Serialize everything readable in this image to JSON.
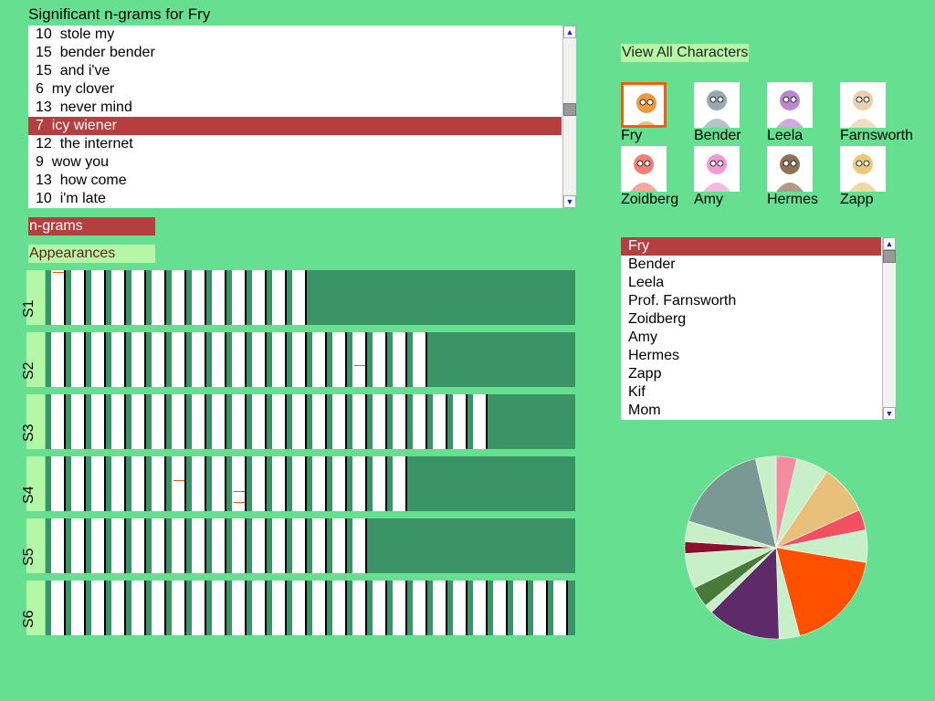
{
  "ngram_panel": {
    "title": "Significant n-grams for Fry",
    "items": [
      {
        "count": "10",
        "text": "stole my"
      },
      {
        "count": "15",
        "text": "bender bender"
      },
      {
        "count": "15",
        "text": "and i've"
      },
      {
        "count": "6",
        "text": "my clover"
      },
      {
        "count": "13",
        "text": "never mind"
      },
      {
        "count": "7",
        "text": "icy wiener",
        "selected": true
      },
      {
        "count": "12",
        "text": "the internet"
      },
      {
        "count": "9",
        "text": "wow you"
      },
      {
        "count": "13",
        "text": "how come"
      },
      {
        "count": "10",
        "text": "i'm late"
      }
    ],
    "scroll_position": 0.45
  },
  "view_toggle": {
    "ngrams_label": "n-grams",
    "appearances_label": "Appearances",
    "active": "n-grams"
  },
  "seasons": [
    {
      "label": "S1",
      "episodes": 13,
      "ticks": [
        {
          "episode": 1,
          "pos": 0.03
        }
      ]
    },
    {
      "label": "S2",
      "episodes": 19,
      "ticks": [
        {
          "episode": 16,
          "pos": 0.6
        }
      ]
    },
    {
      "label": "S3",
      "episodes": 22,
      "ticks": []
    },
    {
      "label": "S4",
      "episodes": 18,
      "ticks": [
        {
          "episode": 7,
          "pos": 0.43
        },
        {
          "episode": 10,
          "pos": 0.63
        },
        {
          "episode": 10,
          "pos": 0.83
        }
      ]
    },
    {
      "label": "S5",
      "episodes": 16,
      "ticks": []
    },
    {
      "label": "S6",
      "episodes": 26,
      "ticks": []
    }
  ],
  "characters_panel": {
    "view_all_label": "View All Characters",
    "cards": [
      {
        "name": "Fry",
        "selected": true,
        "color": "#e8891c"
      },
      {
        "name": "Bender",
        "selected": false,
        "color": "#8a9aa6"
      },
      {
        "name": "Leela",
        "selected": false,
        "color": "#b070c8"
      },
      {
        "name": "Farnsworth",
        "selected": false,
        "color": "#e8c79a"
      },
      {
        "name": "Zoidberg",
        "selected": false,
        "color": "#f06a5a"
      },
      {
        "name": "Amy",
        "selected": false,
        "color": "#ee88cc"
      },
      {
        "name": "Hermes",
        "selected": false,
        "color": "#7a5a3a"
      },
      {
        "name": "Zapp",
        "selected": false,
        "color": "#e8c060"
      }
    ],
    "list": [
      "Fry",
      "Bender",
      "Leela",
      "Prof. Farnsworth",
      "Zoidberg",
      "Amy",
      "Hermes",
      "Zapp",
      "Kif",
      "Mom"
    ],
    "selected_index": 0
  },
  "pie": {
    "slices": [
      {
        "value": 3.5,
        "color": "#f48ca0"
      },
      {
        "value": 5.5,
        "color": "#c8f0c8"
      },
      {
        "value": 8.5,
        "color": "#e8c07a"
      },
      {
        "value": 3.5,
        "color": "#f05060"
      },
      {
        "value": 5.5,
        "color": "#c8f0c8"
      },
      {
        "value": 17.5,
        "color": "#ff5000"
      },
      {
        "value": 3.5,
        "color": "#c8f0c8"
      },
      {
        "value": 12.5,
        "color": "#5e2a68"
      },
      {
        "value": 1.5,
        "color": "#c8f0c8"
      },
      {
        "value": 3.5,
        "color": "#4a7a3a"
      },
      {
        "value": 6,
        "color": "#c8f0c8"
      },
      {
        "value": 2,
        "color": "#8a1030"
      },
      {
        "value": 3.5,
        "color": "#c8f0c8"
      },
      {
        "value": 16,
        "color": "#7a9894"
      },
      {
        "value": 3.5,
        "color": "#c8f0c8"
      }
    ]
  }
}
